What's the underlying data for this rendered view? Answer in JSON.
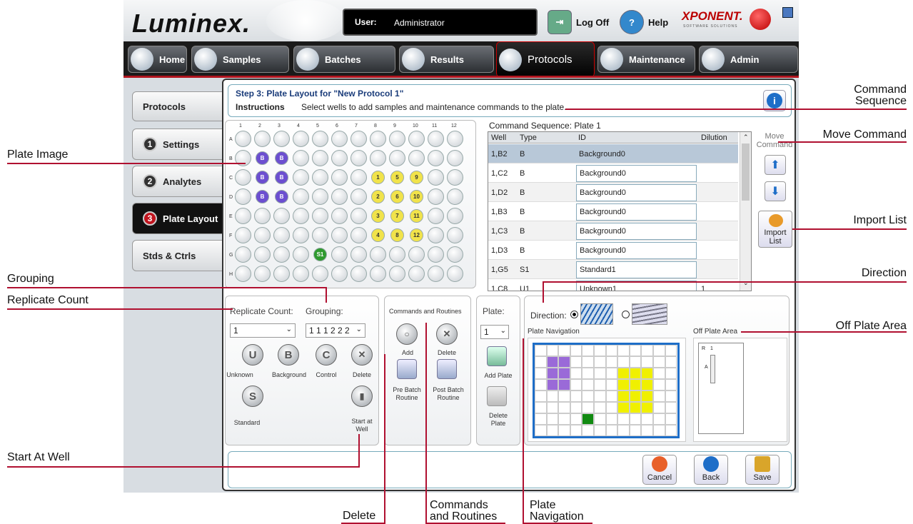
{
  "app": {
    "logo": "Luminex.",
    "user_label": "User:",
    "user_value": "Administrator",
    "logoff": "Log Off",
    "help": "Help",
    "brand": "XPONENT.",
    "brand_sub": "SOFTWARE SOLUTIONS"
  },
  "tabs": [
    "Home",
    "Samples",
    "Batches",
    "Results",
    "Protocols",
    "Maintenance",
    "Admin"
  ],
  "side": {
    "protocols": "Protocols",
    "items": [
      {
        "num": "1",
        "label": "Settings"
      },
      {
        "num": "2",
        "label": "Analytes"
      },
      {
        "num": "3",
        "label": "Plate Layout"
      }
    ],
    "stds": "Stds & Ctrls"
  },
  "step": {
    "title": "Step 3: Plate Layout for \"New Protocol 1\"",
    "instr_label": "Instructions",
    "instr_text": "Select wells to add samples and maintenance commands to the plate."
  },
  "plate": {
    "cols": [
      "1",
      "2",
      "3",
      "4",
      "5",
      "6",
      "7",
      "8",
      "9",
      "10",
      "11",
      "12"
    ],
    "rows": [
      "A",
      "B",
      "C",
      "D",
      "E",
      "F",
      "G",
      "H"
    ]
  },
  "seq": {
    "title": "Command Sequence: Plate 1",
    "headers": [
      "Well",
      "Type",
      "ID",
      "Dilution"
    ],
    "rows": [
      [
        "1,B2",
        "B",
        "Background0",
        ""
      ],
      [
        "1,C2",
        "B",
        "Background0",
        ""
      ],
      [
        "1,D2",
        "B",
        "Background0",
        ""
      ],
      [
        "1,B3",
        "B",
        "Background0",
        ""
      ],
      [
        "1,C3",
        "B",
        "Background0",
        ""
      ],
      [
        "1,D3",
        "B",
        "Background0",
        ""
      ],
      [
        "1,G5",
        "S1",
        "Standard1",
        ""
      ],
      [
        "1,C8",
        "U1",
        "Unknown1",
        "1"
      ]
    ]
  },
  "move": {
    "label": "Move Command",
    "import": "Import List"
  },
  "rep": {
    "count_label": "Replicate Count:",
    "count_value": "1",
    "group_label": "Grouping:",
    "group_value": "1 1 1 2 2 2",
    "unknown": "Unknown",
    "background": "Background",
    "control": "Control",
    "delete": "Delete",
    "standard": "Standard",
    "start": "Start at Well"
  },
  "cmd": {
    "title": "Commands and Routines",
    "add": "Add",
    "delete": "Delete",
    "pre": "Pre Batch Routine",
    "post": "Post Batch Routine"
  },
  "plt": {
    "label": "Plate:",
    "value": "1",
    "add": "Add Plate",
    "delete": "Delete Plate"
  },
  "dir": {
    "label": "Direction:",
    "nav": "Plate Navigation",
    "off": "Off Plate Area",
    "off_r": "R",
    "off_1": "1",
    "off_a": "A"
  },
  "bottom": {
    "cancel": "Cancel",
    "back": "Back",
    "save": "Save"
  },
  "callouts": {
    "plate_image": "Plate Image",
    "grouping": "Grouping",
    "replicate": "Replicate Count",
    "start": "Start At Well",
    "delete": "Delete",
    "cmds": "Commands and Routines",
    "plate_nav": "Plate Navigation",
    "cmd_seq": "Command Sequence",
    "move_cmd": "Move Command",
    "import": "Import List",
    "direction": "Direction",
    "off_plate": "Off Plate Area"
  }
}
